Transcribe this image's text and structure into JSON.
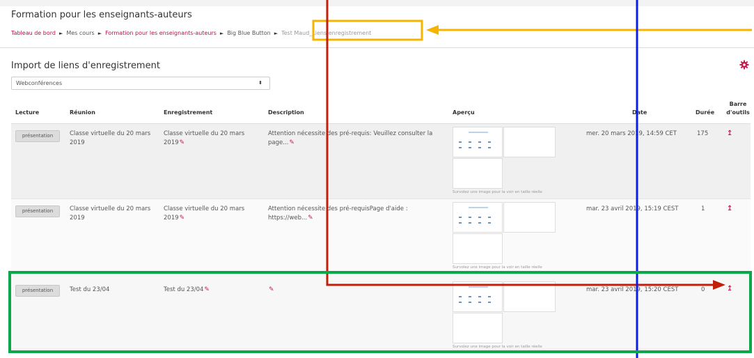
{
  "header": {
    "course_title": "Formation pour les enseignants-auteurs",
    "breadcrumb": [
      {
        "label": "Tableau de bord",
        "kind": "link"
      },
      {
        "label": "Mes cours",
        "kind": "plain"
      },
      {
        "label": "Formation pour les enseignants-auteurs",
        "kind": "link"
      },
      {
        "label": "Big Blue Button",
        "kind": "plain"
      },
      {
        "label": "Test Maud_Liens enregistrement",
        "kind": "current"
      }
    ],
    "separator": "►"
  },
  "section": {
    "title": "Import de liens d'enregistrement",
    "settings_icon": "gear-icon",
    "select_value": "Webconférences"
  },
  "table": {
    "headers": {
      "lecture": "Lecture",
      "reunion": "Réunion",
      "enregistrement": "Enregistrement",
      "description": "Description",
      "apercu": "Aperçu",
      "date": "Date",
      "duree": "Durée",
      "barre": "Barre d'outils"
    },
    "rows": [
      {
        "play_label": "présentation",
        "reunion": "Classe virtuelle du 20 mars 2019",
        "enregistrement": "Classe virtuelle du 20 mars 2019",
        "description": "Attention nécessite des pré-requis: Veuillez consulter la page...",
        "preview_caption": "Survolez une image pour la voir en taille réelle",
        "date": "mer. 20 mars 2019, 14:59 CET",
        "duree": "175"
      },
      {
        "play_label": "présentation",
        "reunion": "Classe virtuelle du 20 mars 2019",
        "enregistrement": "Classe virtuelle du 20 mars 2019",
        "description": "Attention nécessite des pré-requisPage d'aide : https://web...",
        "preview_caption": "Survolez une image pour la voir en taille réelle",
        "date": "mar. 23 avril 2019, 15:19 CEST",
        "duree": "1"
      },
      {
        "play_label": "présentation",
        "reunion": "Test du 23/04",
        "enregistrement": "Test du 23/04",
        "description": "",
        "preview_caption": "Survolez une image pour la voir en taille réelle",
        "date": "mar. 23 avril 2019, 15:20 CEST",
        "duree": "0"
      }
    ]
  },
  "colors": {
    "accent": "#c9194c",
    "annotation_yellow": "#f5b400",
    "annotation_red": "#c0200a",
    "annotation_blue": "#0a1ee6",
    "annotation_green": "#0aa84a"
  }
}
